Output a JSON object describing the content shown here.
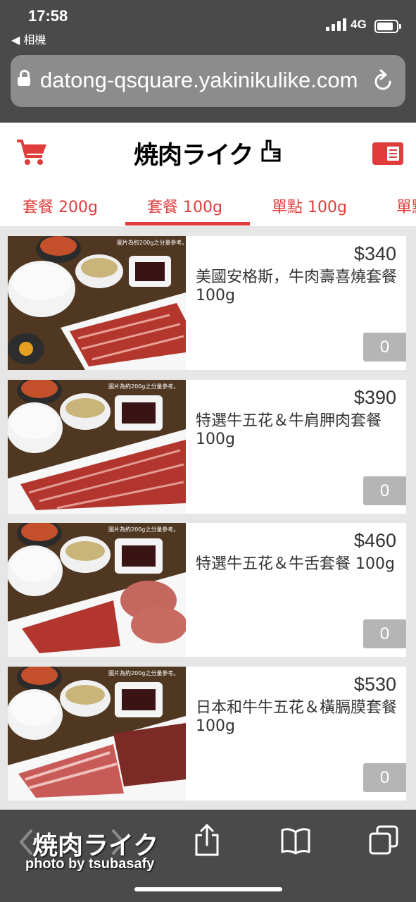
{
  "status_bar": {
    "time": "17:58",
    "back_app": "◀ 相機",
    "network": "4G"
  },
  "browser": {
    "url": "datong-qsquare.yakinikulike.com"
  },
  "site": {
    "logo_text": "焼肉ライク"
  },
  "tabs": [
    {
      "label": "套餐 200g",
      "active": false
    },
    {
      "label": "套餐 100g",
      "active": true
    },
    {
      "label": "單點 100g",
      "active": false
    },
    {
      "label": "單點",
      "active": false
    }
  ],
  "photo_caption": "圖片為約200g之分量參考。",
  "items": [
    {
      "price": "$340",
      "name": "美國安格斯，牛肉壽喜燒套餐 100g",
      "qty": "0"
    },
    {
      "price": "$390",
      "name": "特選牛五花＆牛肩胛肉套餐 100g",
      "qty": "0"
    },
    {
      "price": "$460",
      "name": "特選牛五花＆牛舌套餐 100g",
      "qty": "0"
    },
    {
      "price": "$530",
      "name": "日本和牛牛五花＆橫膈膜套餐 100g",
      "qty": "0"
    }
  ],
  "watermark": {
    "title": "焼肉ライク",
    "credit": "photo by tsubasafy"
  },
  "colors": {
    "accent": "#e03c3c",
    "chrome": "#4a4a4a",
    "qty_bg": "#b5b5b5"
  }
}
